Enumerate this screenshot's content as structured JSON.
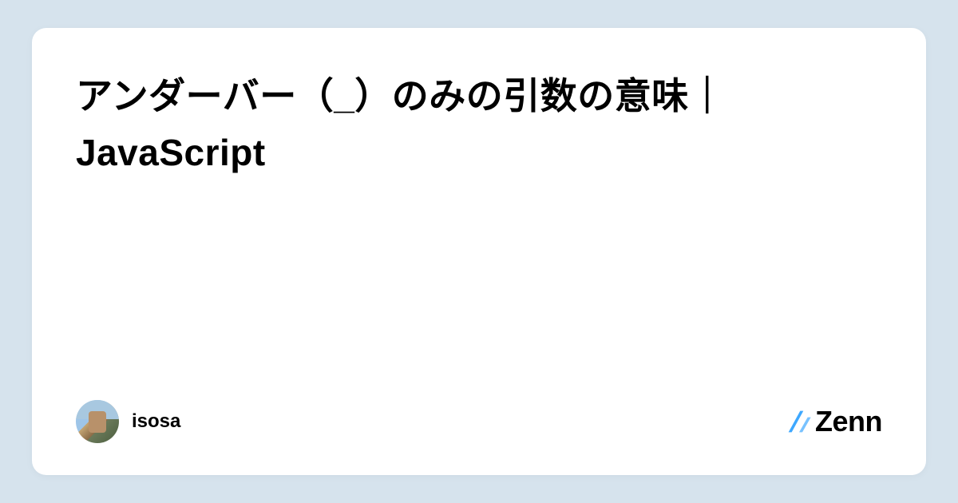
{
  "title": "アンダーバー（_）のみの引数の意味｜ JavaScript",
  "author": {
    "name": "isosa"
  },
  "brand": {
    "name": "Zenn",
    "accent": "#3ea8ff"
  }
}
